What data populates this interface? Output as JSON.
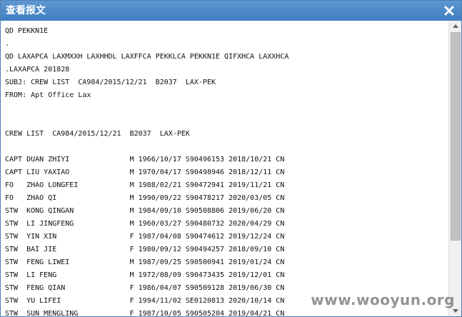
{
  "dialog": {
    "title": "查看报文",
    "close_icon": "close-icon"
  },
  "message_lines": [
    "QD PEKKN1E",
    ".",
    "QD LAXAPCA LAXMXXH LAXHHDL LAXFFCA PEKKLCA PEKKN1E QIFXHCA LAXXHCA",
    ".LAXAPCA 201828",
    "SUBJ: CREW LIST  CA984/2015/12/21  B2037  LAX-PEK",
    "FROM: Apt Office Lax",
    "",
    "",
    "CREW LIST  CA984/2015/12/21  B2037  LAX-PEK",
    "",
    "CAPT DUAN ZHIYI              M 1966/10/17 S90496153 2018/10/21 CN",
    "CAPT LIU YAXIAO              M 1970/04/17 S90498946 2018/12/11 CN",
    "FO   ZHAO LONGFEI            M 1988/02/21 S90472941 2019/11/21 CN",
    "FO   ZHAO QI                 M 1990/09/22 S90478217 2020/03/05 CN",
    "STW  KONG QINGAN             M 1984/09/10 S90508806 2019/06/20 CN",
    "STW  LI JINGFENG             M 1960/03/27 S90480732 2020/04/29 CN",
    "STW  YIN XIN                 F 1987/04/08 S90474612 2019/12/24 CN",
    "STW  BAI JIE                 F 1980/09/12 S90494257 2018/09/10 CN",
    "STW  FENG LIWEI              M 1987/09/25 S90500941 2019/01/24 CN",
    "STW  LI FENG                 M 1972/08/09 S90473435 2019/12/01 CN",
    "STW  FENG QIAN               F 1986/04/07 S90509128 2019/06/30 CN",
    "STW  YU LIFEI                F 1994/11/02 SE0120813 2020/10/14 CN",
    "STW  SUN MENGLING            F 1987/10/05 S90505204 2019/04/21 CN"
  ],
  "watermark": "www.wooyun.org"
}
